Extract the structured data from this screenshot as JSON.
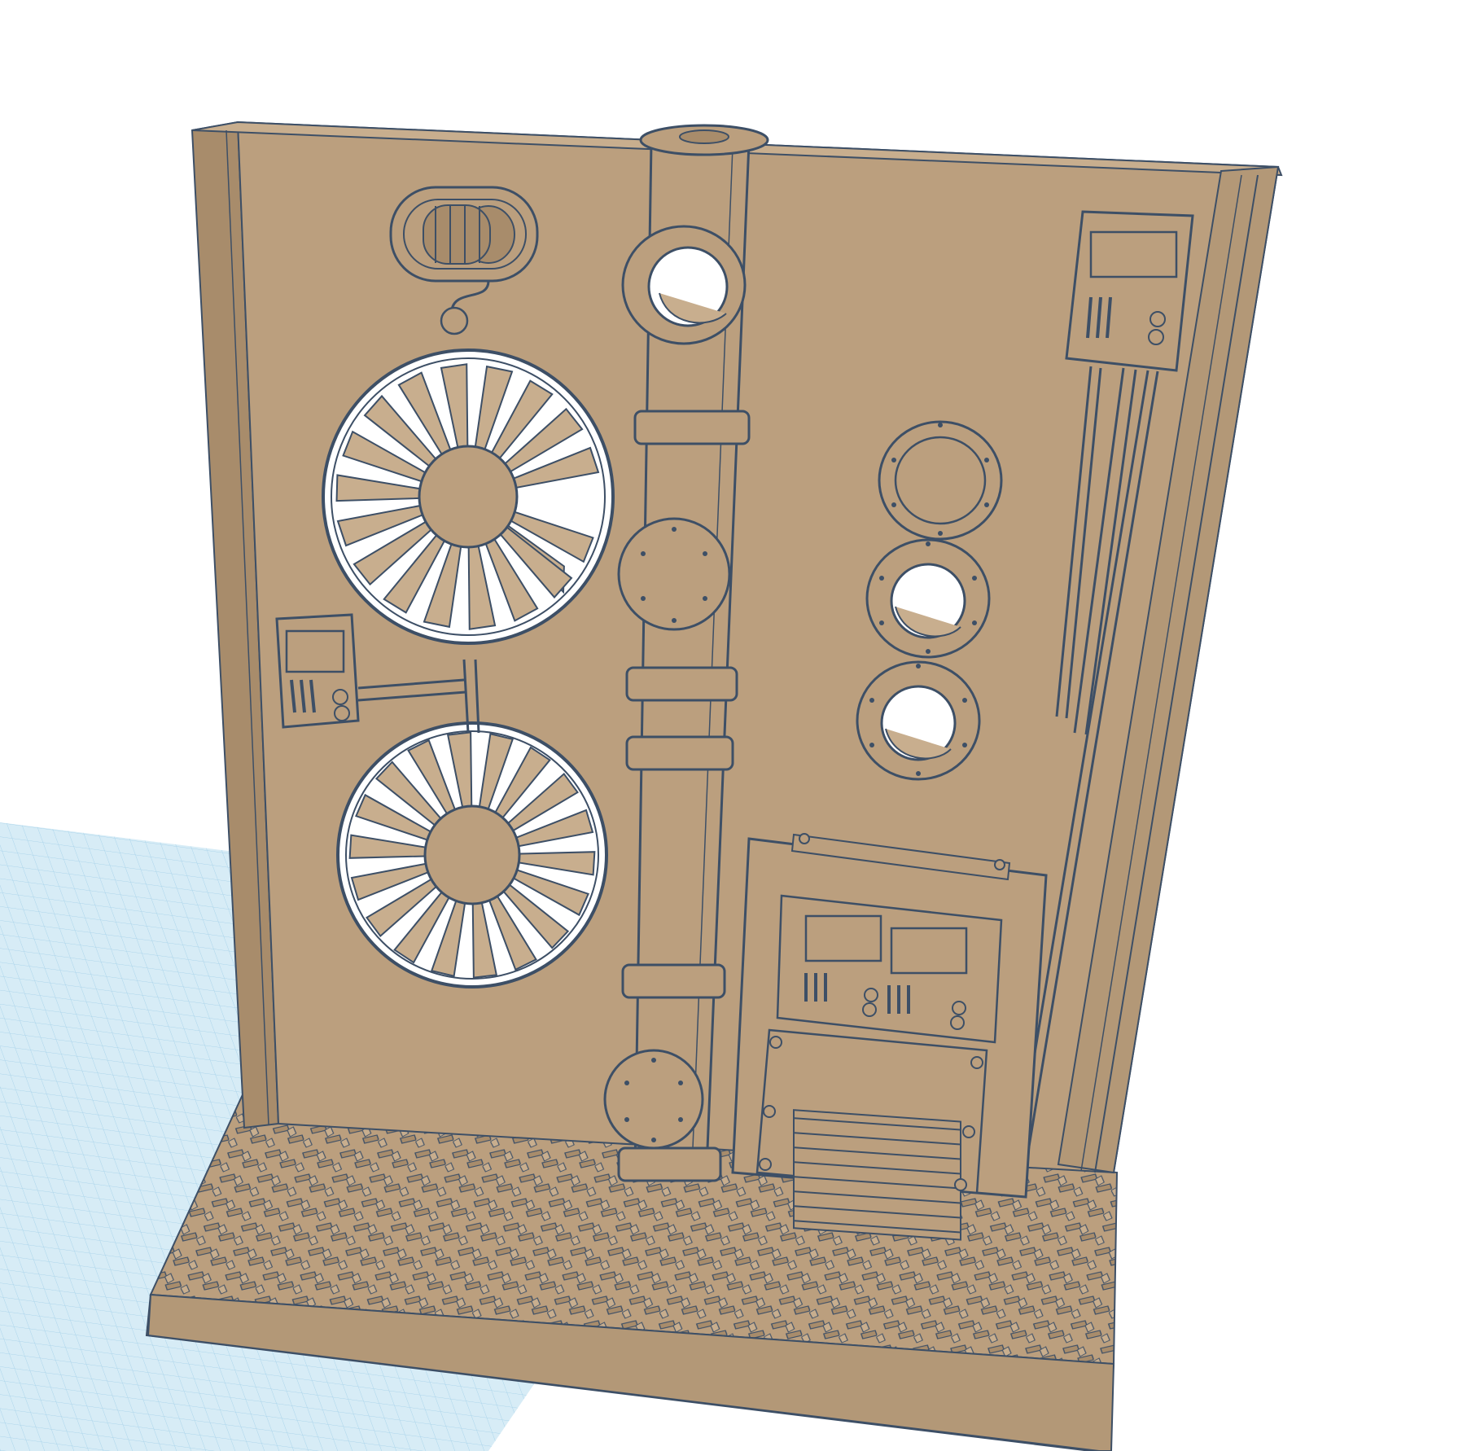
{
  "viewport": {
    "background": "#ffffff",
    "grid_color": "#a9d3ea",
    "grid_fill": "#d7ecf6",
    "object_color": "#bb9f7e",
    "object_shade": "#a88c6b",
    "outline_color": "#3d4f66"
  },
  "model": {
    "name": "",
    "icons": [
      "fan-icon",
      "fan-icon",
      "porthole-icon",
      "control-panel-icon",
      "pipe-icon",
      "coil-icon",
      "vent-grille-icon"
    ]
  }
}
